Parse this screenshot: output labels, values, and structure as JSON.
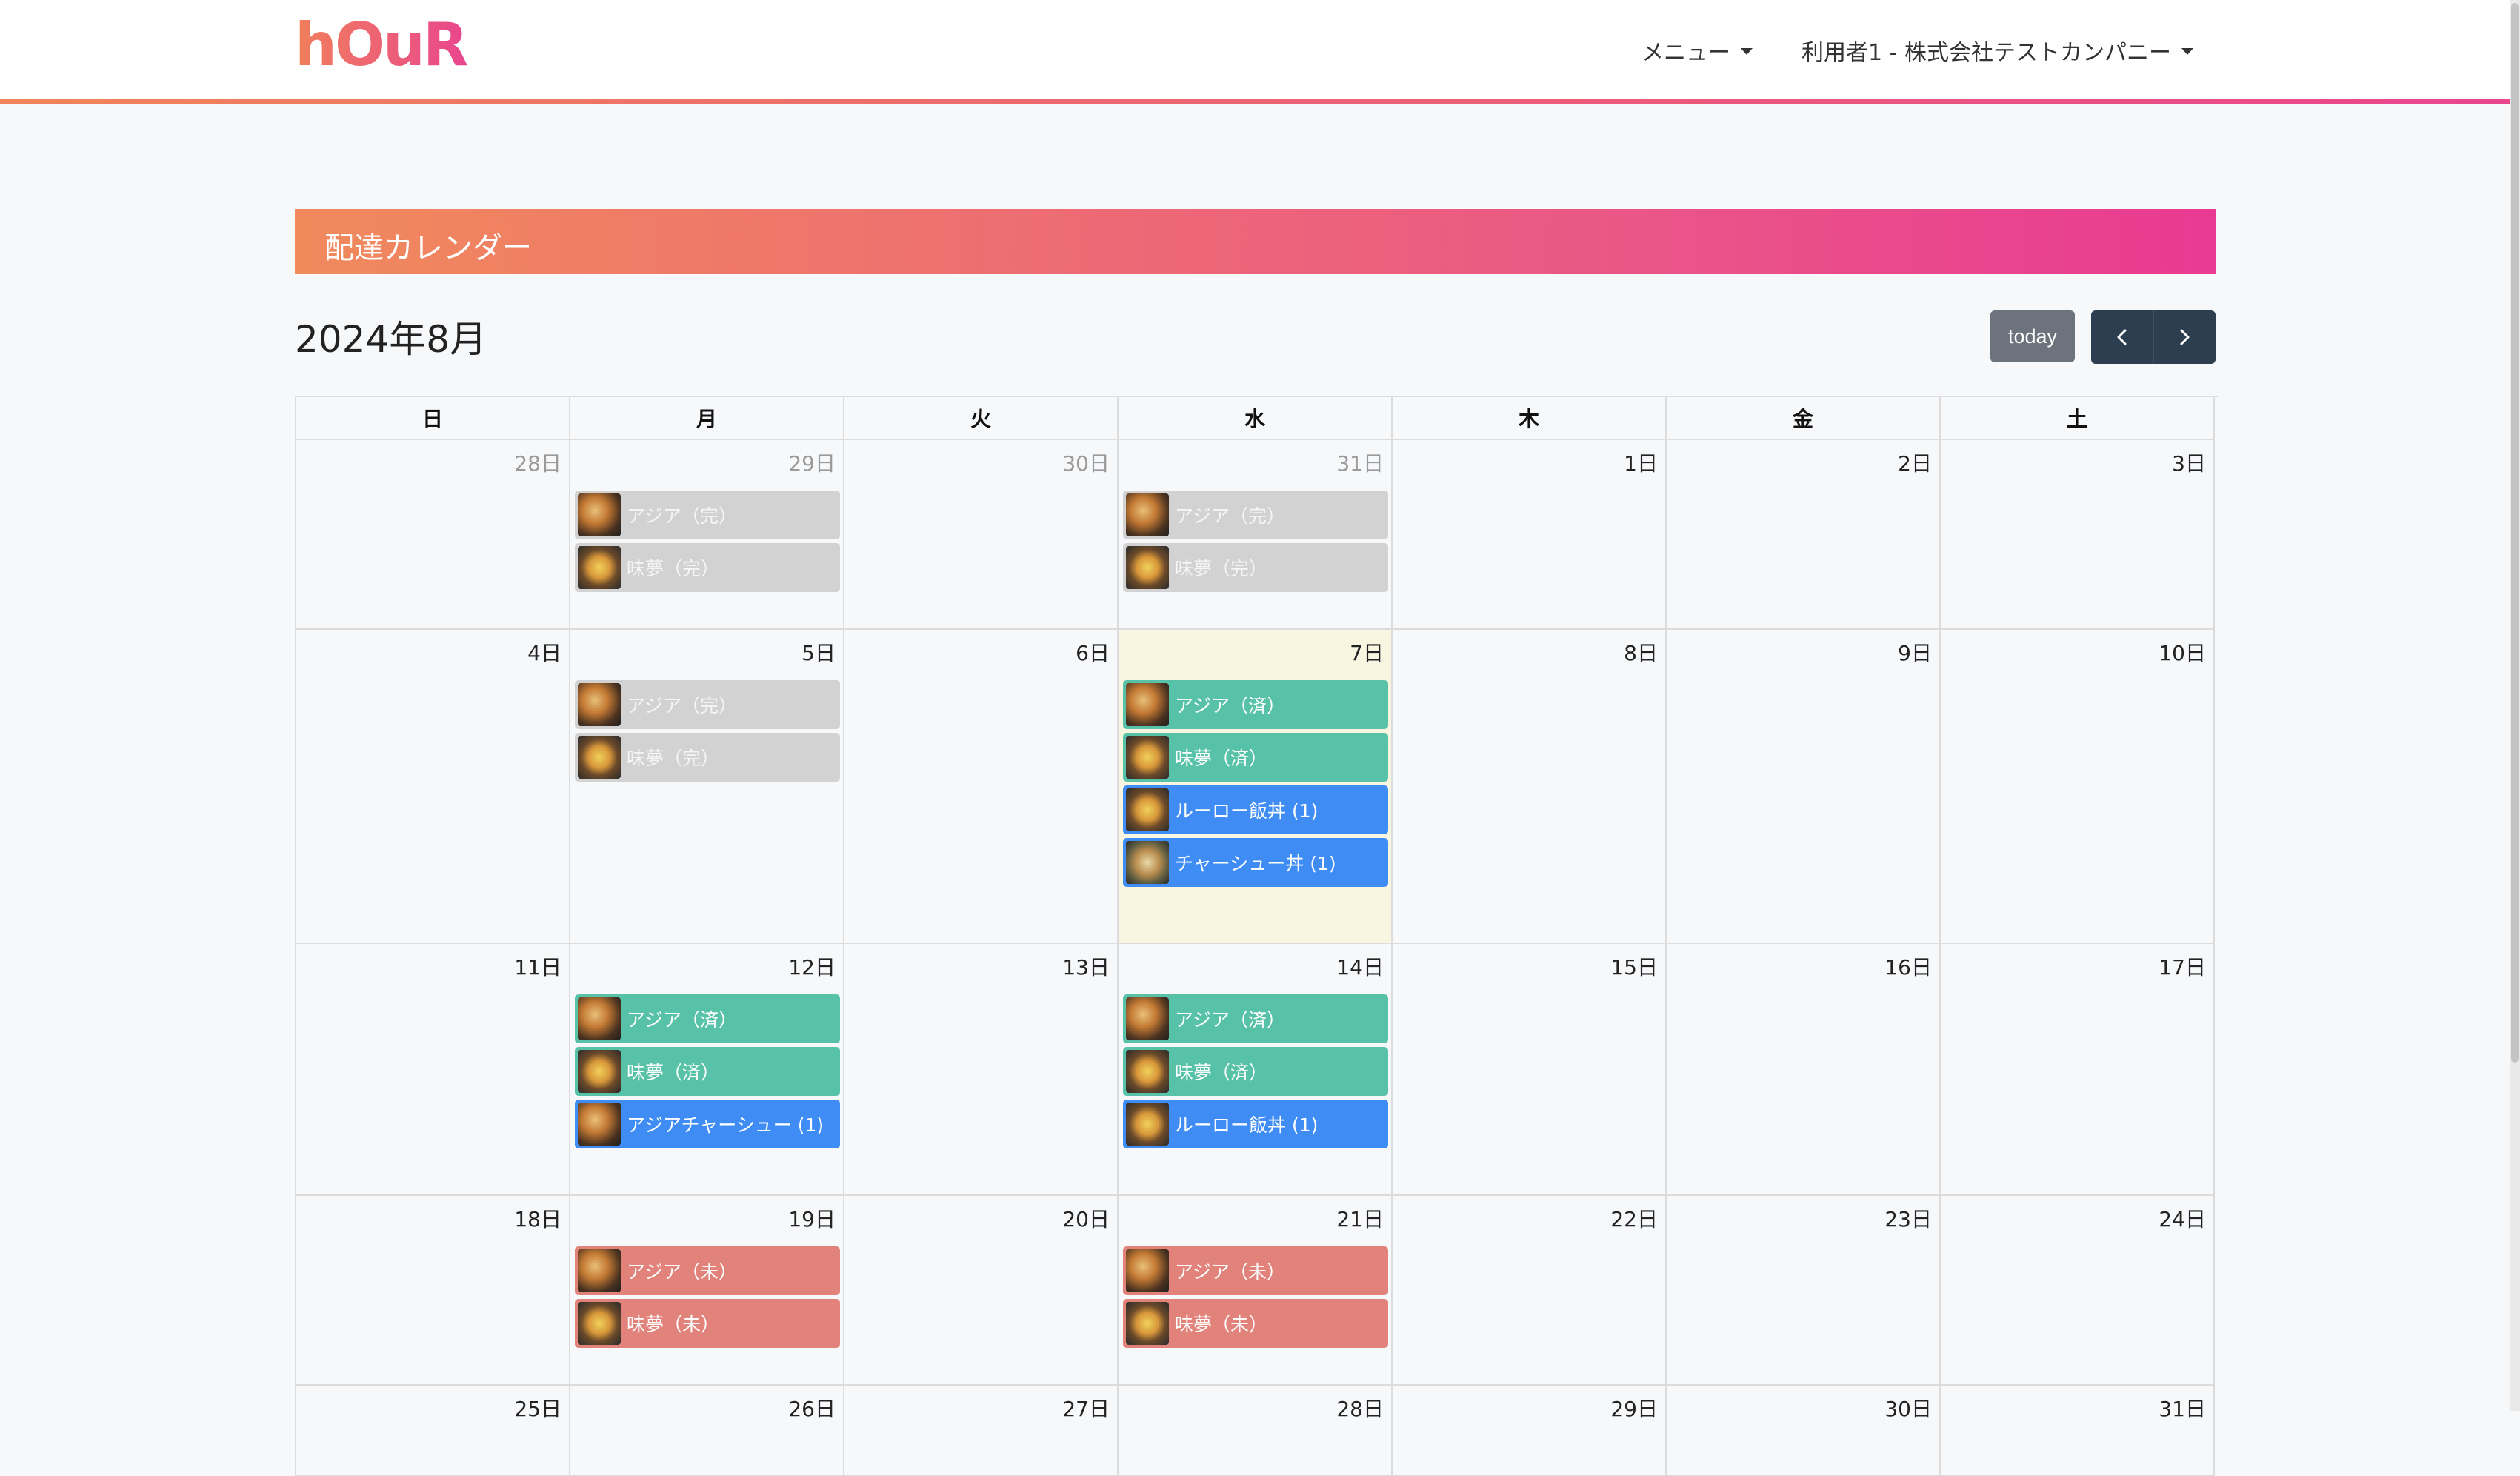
{
  "nav": {
    "logo": "hOuR",
    "menu_label": "メニュー",
    "user_label": "利用者1 - 株式会社テストカンパニー"
  },
  "page": {
    "banner_title": "配達カレンダー",
    "month_title": "2024年8月",
    "today_label": "today",
    "prev_icon": "chevron-left-icon",
    "next_icon": "chevron-right-icon"
  },
  "colors": {
    "brand_start": "#f0845a",
    "brand_end": "#e9468e",
    "event_done": "#d2d2d2",
    "event_delivered": "#58c2a8",
    "event_order": "#3f8df4",
    "event_pending": "#e1837a",
    "today_bg": "#f8f5e1"
  },
  "calendar": {
    "weekdays": [
      "日",
      "月",
      "火",
      "水",
      "木",
      "金",
      "土"
    ],
    "weeks": [
      {
        "days": [
          {
            "label": "28日",
            "other": true,
            "events": []
          },
          {
            "label": "29日",
            "other": true,
            "events": [
              {
                "title": "アジア（完）",
                "status": "done",
                "thumb": "plate"
              },
              {
                "title": "味夢（完）",
                "status": "done",
                "thumb": "bowl"
              }
            ]
          },
          {
            "label": "30日",
            "other": true,
            "events": []
          },
          {
            "label": "31日",
            "other": true,
            "events": [
              {
                "title": "アジア（完）",
                "status": "done",
                "thumb": "plate"
              },
              {
                "title": "味夢（完）",
                "status": "done",
                "thumb": "bowl"
              }
            ]
          },
          {
            "label": "1日",
            "events": []
          },
          {
            "label": "2日",
            "events": []
          },
          {
            "label": "3日",
            "events": []
          }
        ]
      },
      {
        "days": [
          {
            "label": "4日",
            "events": []
          },
          {
            "label": "5日",
            "events": [
              {
                "title": "アジア（完）",
                "status": "done",
                "thumb": "plate"
              },
              {
                "title": "味夢（完）",
                "status": "done",
                "thumb": "bowl"
              }
            ]
          },
          {
            "label": "6日",
            "events": []
          },
          {
            "label": "7日",
            "today": true,
            "events": [
              {
                "title": "アジア（済）",
                "status": "green",
                "thumb": "plate"
              },
              {
                "title": "味夢（済）",
                "status": "green",
                "thumb": "bowl"
              },
              {
                "title": "ルーロー飯丼 (1)",
                "status": "blue",
                "thumb": "bowl"
              },
              {
                "title": "チャーシュー丼 (1)",
                "status": "blue",
                "thumb": "bowl2"
              }
            ]
          },
          {
            "label": "8日",
            "events": []
          },
          {
            "label": "9日",
            "events": []
          },
          {
            "label": "10日",
            "events": []
          }
        ]
      },
      {
        "days": [
          {
            "label": "11日",
            "events": []
          },
          {
            "label": "12日",
            "events": [
              {
                "title": "アジア（済）",
                "status": "green",
                "thumb": "plate"
              },
              {
                "title": "味夢（済）",
                "status": "green",
                "thumb": "bowl"
              },
              {
                "title": "アジアチャーシュー (1)",
                "status": "blue",
                "thumb": "plate"
              }
            ]
          },
          {
            "label": "13日",
            "events": []
          },
          {
            "label": "14日",
            "events": [
              {
                "title": "アジア（済）",
                "status": "green",
                "thumb": "plate"
              },
              {
                "title": "味夢（済）",
                "status": "green",
                "thumb": "bowl"
              },
              {
                "title": "ルーロー飯丼 (1)",
                "status": "blue",
                "thumb": "bowl"
              }
            ]
          },
          {
            "label": "15日",
            "events": []
          },
          {
            "label": "16日",
            "events": []
          },
          {
            "label": "17日",
            "events": []
          }
        ]
      },
      {
        "days": [
          {
            "label": "18日",
            "events": []
          },
          {
            "label": "19日",
            "events": [
              {
                "title": "アジア（未）",
                "status": "red",
                "thumb": "plate"
              },
              {
                "title": "味夢（未）",
                "status": "red",
                "thumb": "bowl"
              }
            ]
          },
          {
            "label": "20日",
            "events": []
          },
          {
            "label": "21日",
            "events": [
              {
                "title": "アジア（未）",
                "status": "red",
                "thumb": "plate"
              },
              {
                "title": "味夢（未）",
                "status": "red",
                "thumb": "bowl"
              }
            ]
          },
          {
            "label": "22日",
            "events": []
          },
          {
            "label": "23日",
            "events": []
          },
          {
            "label": "24日",
            "events": []
          }
        ]
      },
      {
        "days": [
          {
            "label": "25日",
            "events": []
          },
          {
            "label": "26日",
            "events": []
          },
          {
            "label": "27日",
            "events": []
          },
          {
            "label": "28日",
            "events": []
          },
          {
            "label": "29日",
            "events": []
          },
          {
            "label": "30日",
            "events": []
          },
          {
            "label": "31日",
            "events": []
          }
        ]
      }
    ]
  }
}
